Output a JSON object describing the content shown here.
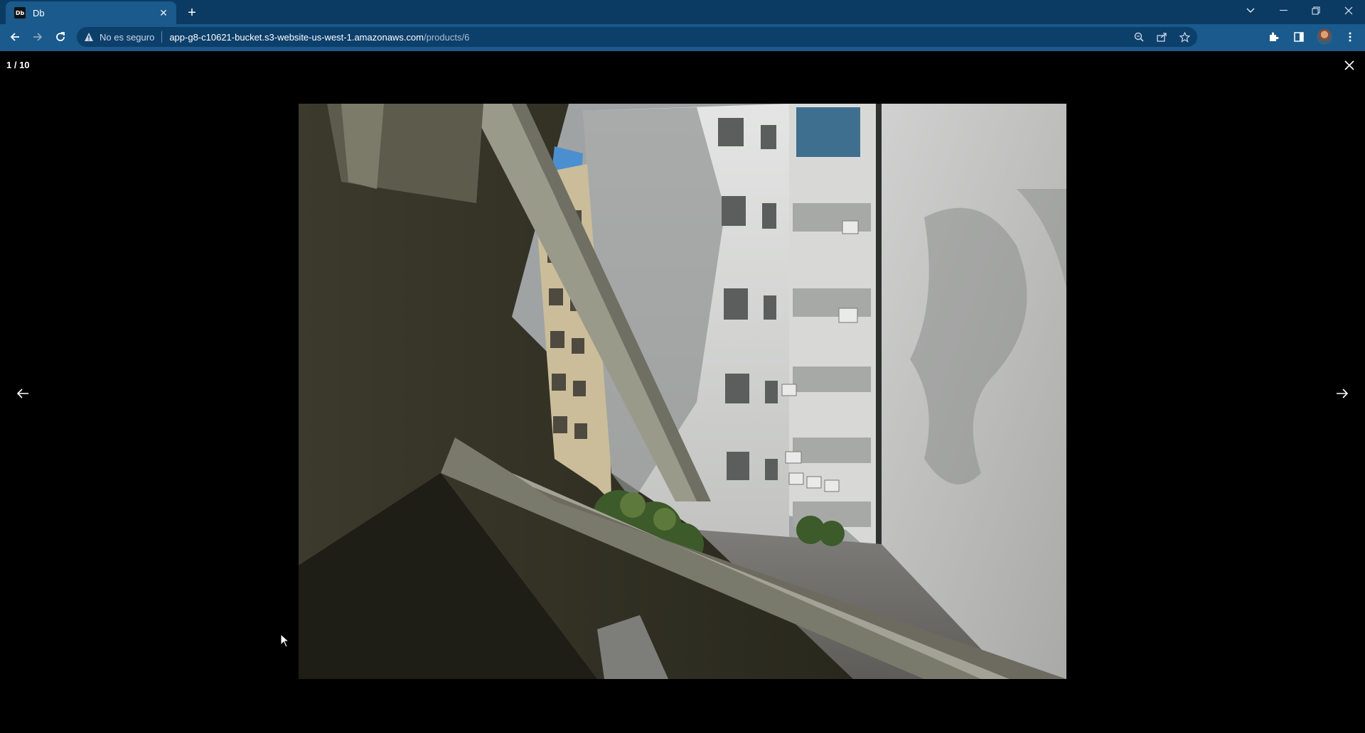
{
  "browser": {
    "tab_title": "Db",
    "favicon_text": "Db",
    "security_label": "No es seguro",
    "url_host": "app-g8-c10621-bucket.s3-website-us-west-1.amazonaws.com",
    "url_path": "/products/6"
  },
  "gallery": {
    "counter": "1 / 10",
    "current": 1,
    "total": 10
  },
  "icons": {
    "close": "close-icon",
    "prev": "arrow-left-icon",
    "next": "arrow-right-icon"
  },
  "colors": {
    "tabstrip": "#0b3a63",
    "toolbar": "#1a5a8c",
    "backdrop": "#000000"
  }
}
